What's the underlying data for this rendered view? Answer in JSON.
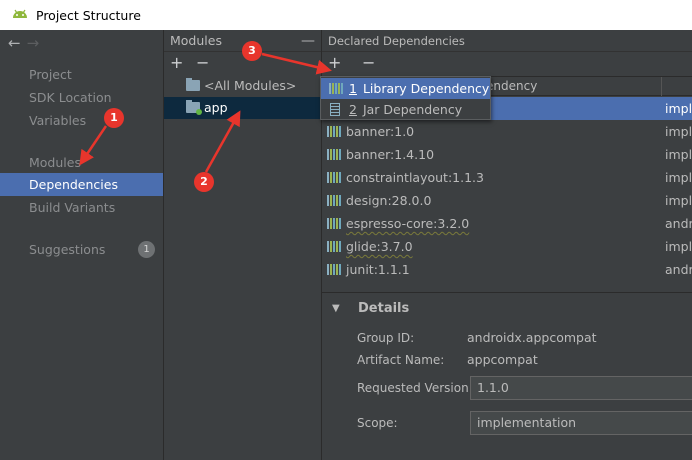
{
  "window": {
    "title": "Project Structure"
  },
  "nav": {
    "back": "←",
    "forward": "→",
    "items": [
      {
        "label": "Project"
      },
      {
        "label": "SDK Location"
      },
      {
        "label": "Variables"
      },
      {
        "label": "Modules"
      },
      {
        "label": "Dependencies"
      },
      {
        "label": "Build Variants"
      }
    ],
    "suggestions": {
      "label": "Suggestions",
      "count": "1"
    }
  },
  "modules": {
    "header": "Modules",
    "collapse": "—",
    "add": "+",
    "remove": "−",
    "items": [
      {
        "label": "<All Modules>"
      },
      {
        "label": "app"
      }
    ]
  },
  "dependencies": {
    "header": "Declared Dependencies",
    "add": "+",
    "remove": "−",
    "column_tail": "endency",
    "rows": [
      {
        "name": "",
        "scope": "imple"
      },
      {
        "name": "banner:1.0",
        "scope": "imple"
      },
      {
        "name": "banner:1.4.10",
        "scope": "imple"
      },
      {
        "name": "constraintlayout:1.1.3",
        "scope": "imple"
      },
      {
        "name": "design:28.0.0",
        "scope": "imple"
      },
      {
        "name": "espresso-core:3.2.0",
        "scope": "andr"
      },
      {
        "name": "glide:3.7.0",
        "scope": "imple"
      },
      {
        "name": "junit:1.1.1",
        "scope": "andr"
      }
    ]
  },
  "popup": {
    "items": [
      {
        "num": "1",
        "label": "Library Dependency"
      },
      {
        "num": "2",
        "label": "Jar Dependency"
      }
    ]
  },
  "details": {
    "title": "Details",
    "group_id_label": "Group ID:",
    "group_id": "androidx.appcompat",
    "artifact_label": "Artifact Name:",
    "artifact": "appcompat",
    "version_label": "Requested Version:",
    "version": "1.1.0",
    "scope_label": "Scope:",
    "scope": "implementation"
  },
  "annotations": [
    "1",
    "2",
    "3"
  ],
  "colors": {
    "selection": "#4b6eaf",
    "marker": "#e8352c",
    "background": "#3c3f41"
  }
}
